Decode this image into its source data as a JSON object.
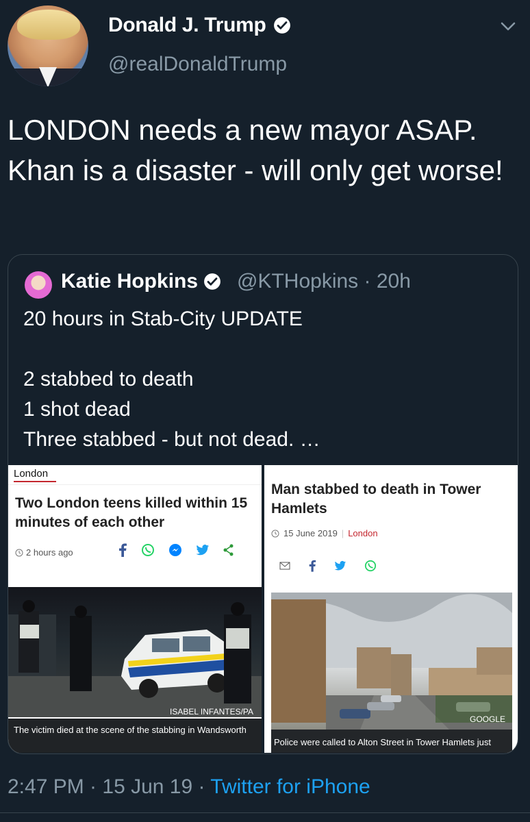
{
  "author": {
    "name": "Donald J. Trump",
    "handle": "@realDonaldTrump",
    "avatar_icon": "profile-photo",
    "verified_icon": "verified-badge-icon"
  },
  "tweet": {
    "text": "LONDON needs a new mayor ASAP. Khan is a disaster - will only get worse!",
    "timestamp": "2:47 PM · 15 Jun 19 · ",
    "source": "Twitter for iPhone"
  },
  "quote": {
    "name": "Katie Hopkins",
    "handle_time": "@KTHopkins · 20h",
    "text": "20 hours in Stab-City UPDATE\n\n2 stabbed to death\n1 shot dead\nThree stabbed - but not dead. …",
    "left_article": {
      "section": "London",
      "headline": "Two London teens killed within 15 minutes of each other",
      "time": "2 hours ago",
      "credit": "ISABEL INFANTES/PA",
      "caption": "The victim died at the scene of the stabbing in Wandsworth"
    },
    "right_article": {
      "headline": "Man stabbed to death in Tower Hamlets",
      "date": "15 June 2019",
      "location": "London",
      "credit": "GOOGLE",
      "caption": "Police were called to Alton Street in Tower Hamlets just"
    }
  },
  "colors": {
    "background": "#15202b",
    "secondary_text": "#8899a6",
    "link": "#1da1f2",
    "bbc_red": "#c4262e"
  }
}
